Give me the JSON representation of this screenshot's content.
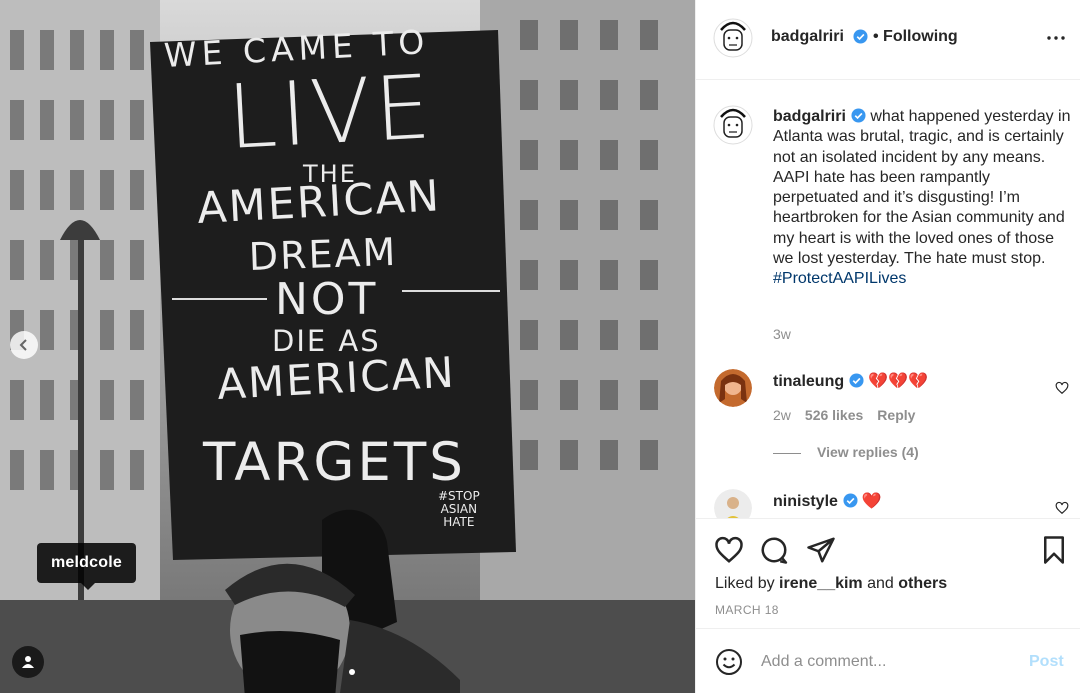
{
  "post": {
    "author": "badgalriri",
    "follow_status": "• Following",
    "caption_text": "what happened yesterday in Atlanta was brutal, tragic, and is certainly not an isolated incident by any means. AAPI hate has been rampantly perpetuated and it’s disgusting! I’m heartbroken for the Asian community and my heart is with the loved ones of those we lost yesterday. The hate must stop.",
    "hashtag": "#ProtectAAPILives",
    "caption_time": "3w",
    "liked_by_prefix": "Liked by",
    "liked_by_user": "irene__kim",
    "liked_by_and": "and",
    "liked_by_others": "others",
    "date": "MARCH 18"
  },
  "photo": {
    "tagged_user": "meldcole",
    "sign_lines": [
      "WE CAME TO",
      "LIVE",
      "THE",
      "AMERICAN",
      "DREAM",
      "NOT",
      "DIE AS",
      "AMERICAN",
      "TARGETS"
    ],
    "sign_hashtag": [
      "#STOP",
      "ASIAN",
      "HATE"
    ],
    "carousel_total": 2,
    "carousel_index": 1
  },
  "comments": [
    {
      "user": "tinaleung",
      "text": "💔💔💔",
      "time": "2w",
      "likes": "526 likes",
      "reply": "Reply",
      "view_replies": "View replies (4)"
    },
    {
      "user": "ninistyle",
      "text": "❤️"
    }
  ],
  "add_comment": {
    "placeholder": "Add a comment...",
    "post_label": "Post"
  },
  "colors": {
    "link": "#00376b",
    "verified": "#3897f0",
    "post_disabled": "#b2dffc",
    "muted": "#8e8e8e"
  },
  "icons": [
    "chevron-left-icon",
    "user-tag-icon",
    "more-icon",
    "verified-icon",
    "heart-icon",
    "comment-icon",
    "share-icon",
    "bookmark-icon",
    "emoji-icon"
  ]
}
